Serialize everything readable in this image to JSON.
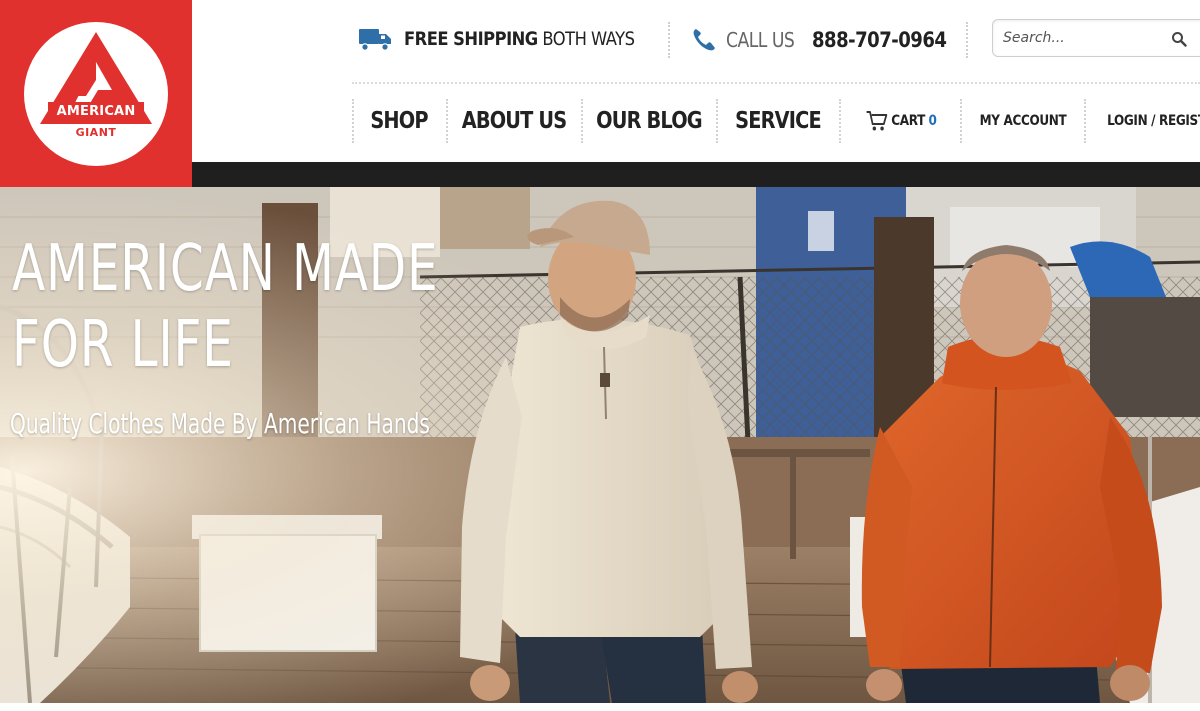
{
  "brand": {
    "line1": "AMERICAN",
    "line2": "GIANT",
    "red": "#e0312f"
  },
  "topbar": {
    "shipping_bold": "FREE SHIPPING",
    "shipping_rest": " BOTH WAYS",
    "shipping_icon": "truck-icon",
    "call_label": "CALL US",
    "phone_number": "888-707-0964",
    "phone_icon": "phone-icon",
    "search_placeholder": "Search...",
    "search_icon": "search-icon"
  },
  "nav": {
    "items": [
      {
        "label": "SHOP"
      },
      {
        "label": "ABOUT US"
      },
      {
        "label": "OUR BLOG"
      },
      {
        "label": "SERVICE"
      }
    ],
    "cart_label": "CART",
    "cart_count": "0",
    "cart_icon": "cart-icon",
    "account_label": "MY ACCOUNT",
    "login_label": "LOGIN / REGISTER",
    "accent": "#1d6fb8"
  },
  "hero": {
    "title_line1": "AMERICAN MADE",
    "title_line2": "FOR LIFE",
    "subtitle": "Quality Clothes Made By American Hands"
  }
}
